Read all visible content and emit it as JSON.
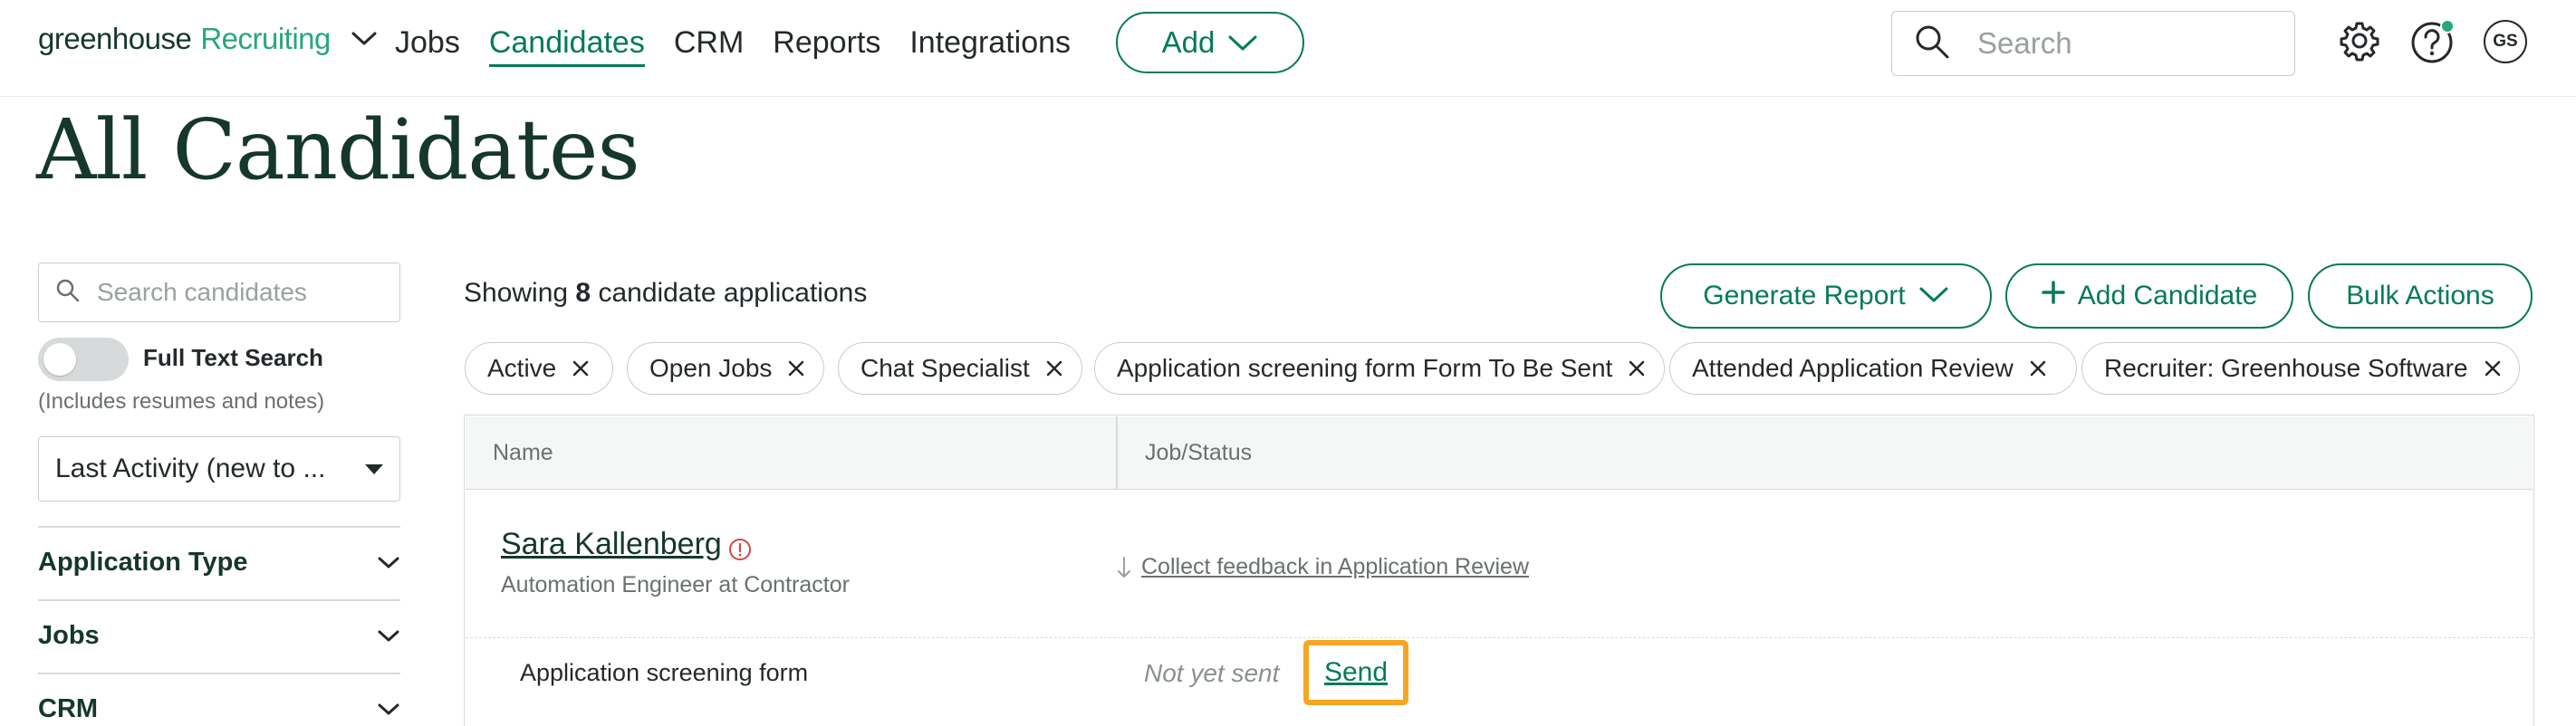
{
  "nav": {
    "logo_main": "greenhouse",
    "logo_product": "Recruiting",
    "links": [
      "Jobs",
      "Candidates",
      "CRM",
      "Reports",
      "Integrations"
    ],
    "active_link": "Candidates",
    "add_label": "Add",
    "search_placeholder": "Search",
    "avatar_initials": "GS"
  },
  "page": {
    "title": "All Candidates"
  },
  "sidebar": {
    "search_placeholder": "Search candidates",
    "full_text_search_label": "Full Text Search",
    "full_text_search_note": "(Includes resumes and notes)",
    "full_text_search_enabled": false,
    "sort_value": "Last Activity (new to ...",
    "facets": [
      "Application Type",
      "Jobs",
      "CRM"
    ]
  },
  "results": {
    "showing_prefix": "Showing",
    "count": "8",
    "showing_suffix": "candidate applications",
    "generate_report_label": "Generate Report",
    "add_candidate_label": "Add Candidate",
    "bulk_actions_label": "Bulk Actions",
    "filters": [
      "Active",
      "Open Jobs",
      "Chat Specialist",
      "Application screening form Form To Be Sent",
      "Attended Application Review",
      "Recruiter: Greenhouse Software"
    ]
  },
  "table": {
    "col_name": "Name",
    "col_job_status": "Job/Status",
    "rows": [
      {
        "name": "Sara Kallenberg",
        "subtitle": "Automation Engineer at Contractor",
        "status": "Collect feedback in Application Review",
        "form_label": "Application screening form",
        "form_state": "Not yet sent",
        "form_action": "Send"
      }
    ]
  },
  "colors": {
    "brand": "#047a5b",
    "highlight": "#f5a623",
    "title": "#15372c"
  }
}
